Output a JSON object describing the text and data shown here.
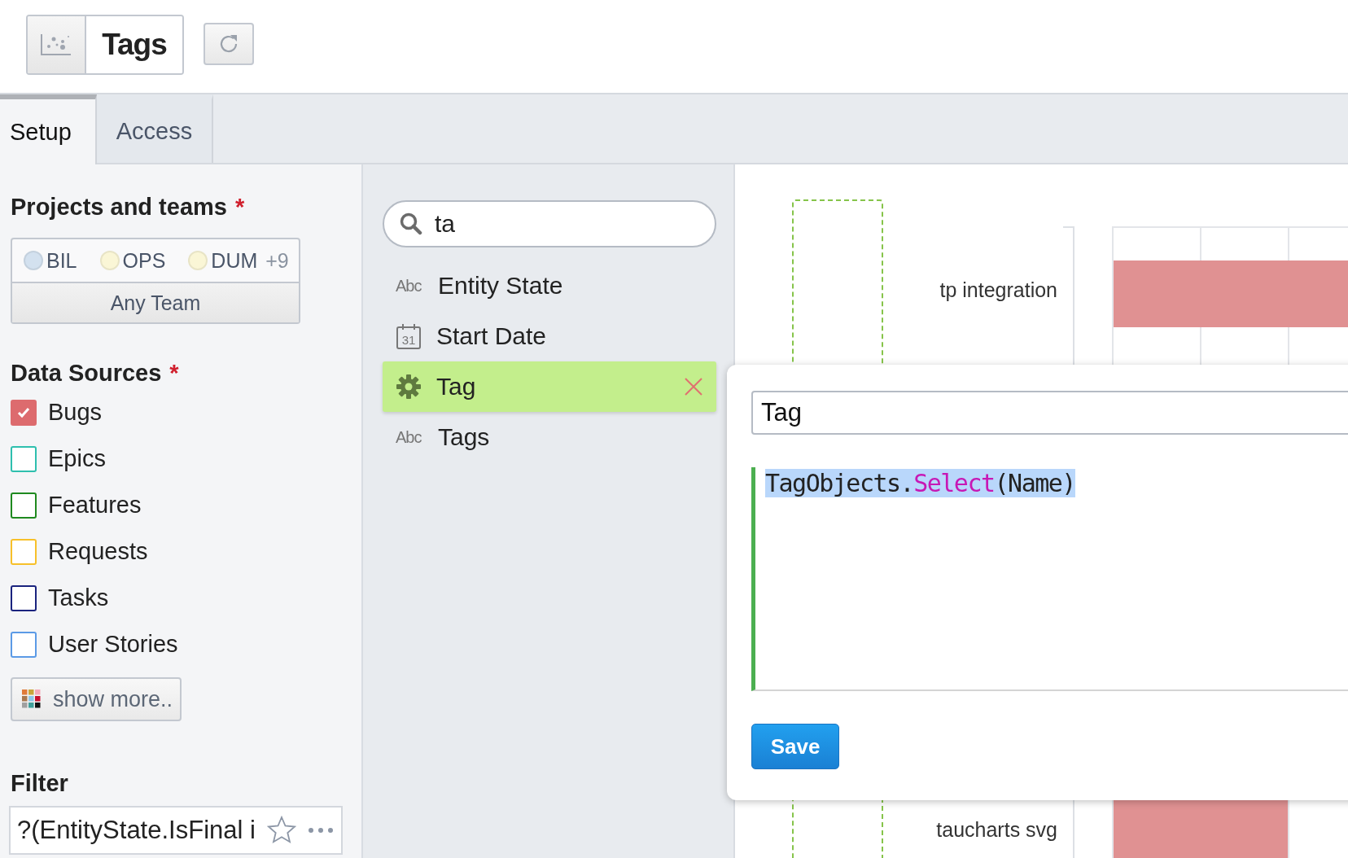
{
  "header": {
    "title": "Tags"
  },
  "tabs": [
    {
      "label": "Setup",
      "selected": true
    },
    {
      "label": "Access",
      "selected": false
    }
  ],
  "projects": {
    "heading": "Projects and teams",
    "required_mark": "*",
    "items": [
      {
        "label": "BIL",
        "color": "#d3e1ef"
      },
      {
        "label": "OPS",
        "color": "#faf6d6"
      },
      {
        "label": "DUM",
        "color": "#faf6d6"
      }
    ],
    "more_count": "+9",
    "team_button": "Any Team"
  },
  "data_sources": {
    "heading": "Data Sources",
    "required_mark": "*",
    "items": [
      {
        "label": "Bugs",
        "checked": true,
        "color": "#dd6b6e"
      },
      {
        "label": "Epics",
        "checked": false,
        "color": "#2ebfae"
      },
      {
        "label": "Features",
        "checked": false,
        "color": "#1f8a1f"
      },
      {
        "label": "Requests",
        "checked": false,
        "color": "#f7c02a"
      },
      {
        "label": "Tasks",
        "checked": false,
        "color": "#1a237e"
      },
      {
        "label": "User Stories",
        "checked": false,
        "color": "#5b9ae6"
      }
    ],
    "show_more": "show more.."
  },
  "filter": {
    "heading": "Filter",
    "value": "?(EntityState.IsFinal i"
  },
  "fields": {
    "search": {
      "value": "ta"
    },
    "items": [
      {
        "label": "Entity State",
        "kind": "text",
        "icon_text": "Abc",
        "selected": false
      },
      {
        "label": "Start Date",
        "kind": "date",
        "icon_text": "31",
        "selected": false
      },
      {
        "label": "Tag",
        "kind": "custom",
        "selected": true
      },
      {
        "label": "Tags",
        "kind": "text",
        "icon_text": "Abc",
        "selected": false
      }
    ]
  },
  "chart": {
    "rows": [
      {
        "label": "tp integration"
      },
      {
        "label": "taucharts svg"
      }
    ]
  },
  "editor": {
    "name": "Tag",
    "code": [
      {
        "text": "TagObjects.",
        "kind": "plain"
      },
      {
        "text": "Select",
        "kind": "method"
      },
      {
        "text": "(Name)",
        "kind": "plain"
      }
    ],
    "save": "Save"
  }
}
